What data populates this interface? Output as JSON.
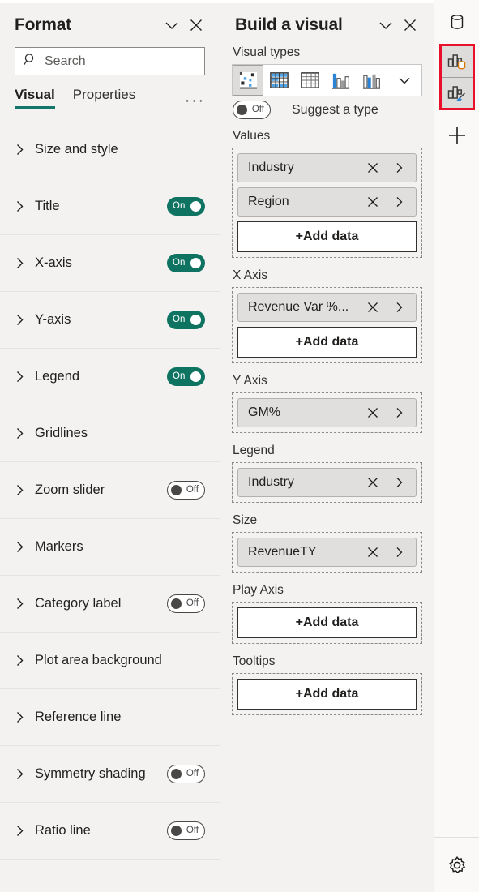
{
  "format_panel": {
    "title": "Format",
    "collapse_icon": "chevron-down-icon",
    "close_icon": "close-icon",
    "search": {
      "placeholder": "Search",
      "value": "",
      "icon": "search-icon"
    },
    "tabs": [
      {
        "label": "Visual",
        "active": true
      },
      {
        "label": "Properties",
        "active": false
      }
    ],
    "more_label": "···",
    "sections": [
      {
        "label": "Size and style",
        "toggle": null
      },
      {
        "label": "Title",
        "toggle": "On"
      },
      {
        "label": "X-axis",
        "toggle": "On"
      },
      {
        "label": "Y-axis",
        "toggle": "On"
      },
      {
        "label": "Legend",
        "toggle": "On"
      },
      {
        "label": "Gridlines",
        "toggle": null
      },
      {
        "label": "Zoom slider",
        "toggle": "Off"
      },
      {
        "label": "Markers",
        "toggle": null
      },
      {
        "label": "Category label",
        "toggle": "Off"
      },
      {
        "label": "Plot area background",
        "toggle": null
      },
      {
        "label": "Reference line",
        "toggle": null
      },
      {
        "label": "Symmetry shading",
        "toggle": "Off"
      },
      {
        "label": "Ratio line",
        "toggle": "Off"
      }
    ]
  },
  "build_panel": {
    "title": "Build a visual",
    "collapse_icon": "chevron-down-icon",
    "close_icon": "close-icon",
    "visual_types_label": "Visual types",
    "visual_types": [
      {
        "name": "scatter-chart-icon",
        "selected": true
      },
      {
        "name": "matrix-table-icon",
        "selected": false
      },
      {
        "name": "table-icon",
        "selected": false
      },
      {
        "name": "clustered-column-chart-icon",
        "selected": false
      },
      {
        "name": "stacked-column-chart-icon",
        "selected": false
      }
    ],
    "visual_types_more_icon": "chevron-down-icon",
    "suggest": {
      "toggle": "Off",
      "label": "Suggest a type"
    },
    "wells": [
      {
        "label": "Values",
        "fields": [
          {
            "name": "Industry"
          },
          {
            "name": "Region"
          }
        ],
        "add_label": "+Add data"
      },
      {
        "label": "X Axis",
        "fields": [
          {
            "name": "Revenue Var %..."
          }
        ],
        "add_label": "+Add data"
      },
      {
        "label": "Y Axis",
        "fields": [
          {
            "name": "GM%"
          }
        ],
        "add_label": null
      },
      {
        "label": "Legend",
        "fields": [
          {
            "name": "Industry"
          }
        ],
        "add_label": null
      },
      {
        "label": "Size",
        "fields": [
          {
            "name": "RevenueTY"
          }
        ],
        "add_label": null
      },
      {
        "label": "Play Axis",
        "fields": [],
        "add_label": "+Add data"
      },
      {
        "label": "Tooltips",
        "fields": [],
        "add_label": "+Add data"
      }
    ]
  },
  "right_rail": {
    "items": [
      {
        "name": "data-model-icon",
        "highlighted": false
      },
      {
        "name": "build-visual-icon",
        "highlighted": true
      },
      {
        "name": "format-visual-icon",
        "highlighted": true
      },
      {
        "name": "add-icon",
        "highlighted": false
      }
    ],
    "gear_icon": "settings-gear-icon"
  },
  "colors": {
    "accent_teal": "#12776a",
    "toggle_on": "#0f7362",
    "highlight_red": "#e8102a",
    "panel_bg": "#f3f2f1",
    "rail_bg": "#faf9f8"
  }
}
